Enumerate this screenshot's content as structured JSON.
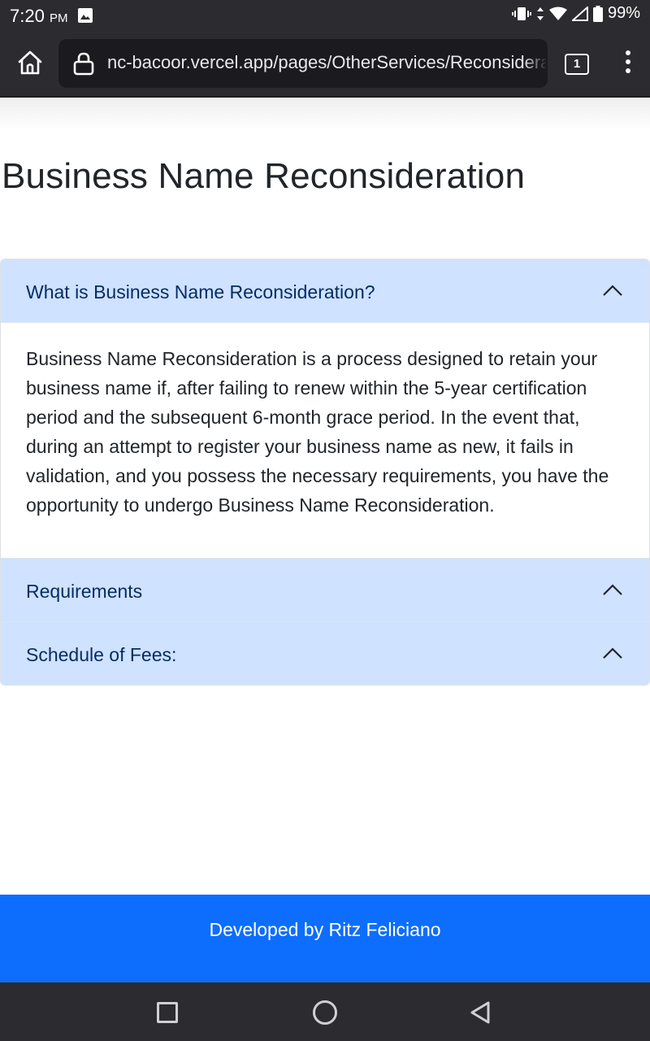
{
  "status_bar": {
    "time": "7:20",
    "ampm": "PM",
    "battery": "99%"
  },
  "browser": {
    "url": "nc-bacoor.vercel.app/pages/OtherServices/Reconsideration",
    "tab_count": "1"
  },
  "page": {
    "title": "Business Name Reconsideration"
  },
  "accordion": {
    "items": [
      {
        "header": "What is Business Name Reconsideration?",
        "body": "Business Name Reconsideration is a process designed to retain your business name if, after failing to renew within the 5-year certification period and the subsequent 6-month grace period. In the event that, during an attempt to register your business name as new, it fails in validation, and you possess the necessary requirements, you have the opportunity to undergo Business Name Reconsideration.",
        "expanded": true
      },
      {
        "header": "Requirements",
        "expanded": false
      },
      {
        "header": "Schedule of Fees:",
        "expanded": false
      }
    ]
  },
  "footer": {
    "text": "Developed by Ritz Feliciano"
  },
  "colors": {
    "accordion_header_bg": "#cfe2ff",
    "accordion_header_text": "#052c65",
    "footer_bg": "#0d6efd",
    "system_bar_bg": "#2b2b30"
  }
}
